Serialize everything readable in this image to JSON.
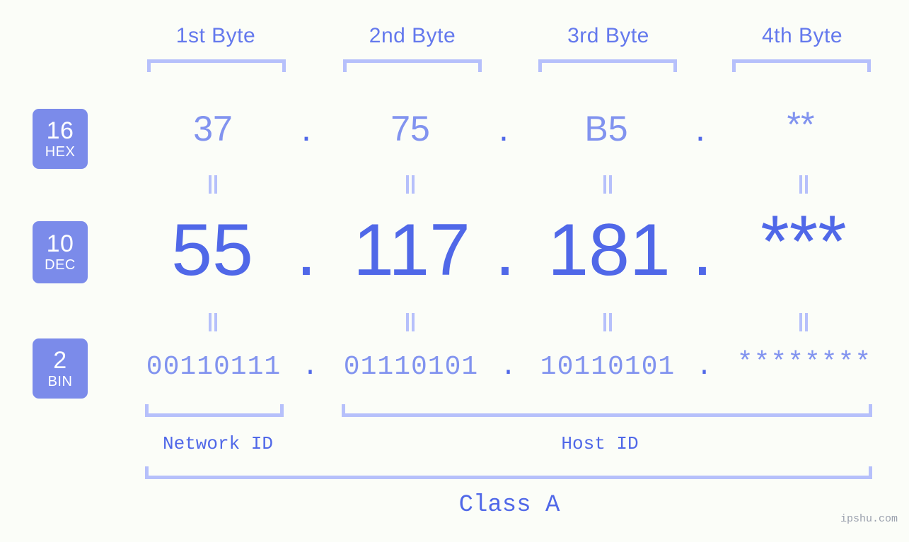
{
  "meta": {
    "background_color": "#fbfdf8",
    "accent_color": "#5068e8",
    "light_accent_color": "#8193ef",
    "bracket_color": "#b6c0fb",
    "badge_color": "#7b8bea",
    "badge_text_color": "#ffffff",
    "watermark": "ipshu.com"
  },
  "byte_headers": [
    {
      "label": "1st Byte"
    },
    {
      "label": "2nd Byte"
    },
    {
      "label": "3rd Byte"
    },
    {
      "label": "4th Byte"
    }
  ],
  "rows": [
    {
      "badge": {
        "number": "16",
        "name": "HEX"
      },
      "values": [
        "37",
        "75",
        "B5",
        "**"
      ],
      "separator": "."
    },
    {
      "badge": {
        "number": "10",
        "name": "DEC"
      },
      "values": [
        "55",
        "117",
        "181",
        "***"
      ],
      "separator": "."
    },
    {
      "badge": {
        "number": "2",
        "name": "BIN"
      },
      "values": [
        "00110111",
        "01110101",
        "10110101",
        "********"
      ],
      "separator": "."
    }
  ],
  "equals_symbol": "=",
  "sections": [
    {
      "label": "Network ID"
    },
    {
      "label": "Host ID"
    }
  ],
  "class_label": "Class A"
}
